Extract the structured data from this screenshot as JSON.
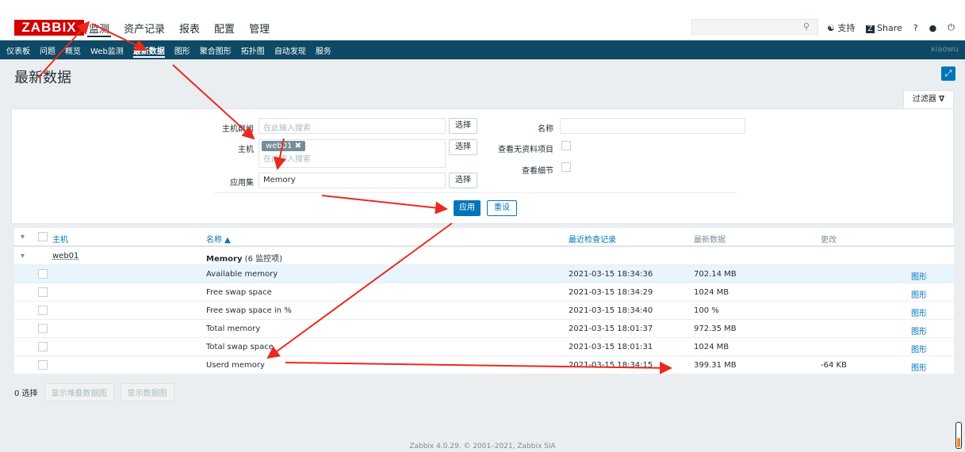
{
  "logo": "ZABBIX",
  "main_menu": [
    "监测",
    "资产记录",
    "报表",
    "配置",
    "管理"
  ],
  "toplinks": {
    "support": "支持",
    "share": "Share",
    "help": "?",
    "user_icon": "user-icon",
    "logout_icon": "power-icon"
  },
  "sub_nav": [
    "仪表板",
    "问题",
    "概览",
    "Web监测",
    "最新数据",
    "图形",
    "聚合图形",
    "拓扑图",
    "自动发现",
    "服务"
  ],
  "sub_nav_user": "xiaowu",
  "page_title": "最新数据",
  "filter": {
    "tab_label": "过滤器",
    "host_group_label": "主机群组",
    "host_group_placeholder": "在此输入搜索",
    "host_label": "主机",
    "host_tag": "web01",
    "host_placeholder": "在此输入搜索",
    "app_label": "应用集",
    "app_value": "Memory",
    "select_label": "选择",
    "name_label": "名称",
    "show_no_data_label": "查看无资料项目",
    "show_details_label": "查看细节",
    "apply": "应用",
    "reset": "重设"
  },
  "table": {
    "headers": {
      "host": "主机",
      "name": "名称 ▲",
      "last_check": "最近检查记录",
      "last_value": "最新数据",
      "change": "更改"
    },
    "group": {
      "host": "web01",
      "name": "Memory",
      "count": "(6 监控项)"
    },
    "rows": [
      {
        "name": "Available memory",
        "last_check": "2021-03-15 18:34:36",
        "last_value": "702.14 MB",
        "change": "",
        "graph": "图形"
      },
      {
        "name": "Free swap space",
        "last_check": "2021-03-15 18:34:29",
        "last_value": "1024 MB",
        "change": "",
        "graph": "图形"
      },
      {
        "name": "Free swap space in %",
        "last_check": "2021-03-15 18:34:40",
        "last_value": "100 %",
        "change": "",
        "graph": "图形"
      },
      {
        "name": "Total memory",
        "last_check": "2021-03-15 18:01:37",
        "last_value": "972.35 MB",
        "change": "",
        "graph": "图形"
      },
      {
        "name": "Total swap space",
        "last_check": "2021-03-15 18:01:31",
        "last_value": "1024 MB",
        "change": "",
        "graph": "图形"
      },
      {
        "name": "Userd memory",
        "last_check": "2021-03-15 18:34:15",
        "last_value": "399.31 MB",
        "change": "-64 KB",
        "graph": "图形"
      }
    ]
  },
  "footer": {
    "selected": "0 选择",
    "stacked_graph": "显示堆叠数据图",
    "graph": "显示数据图"
  },
  "copyright": "Zabbix 4.0.29. © 2001–2021, Zabbix SIA",
  "colors": {
    "brand_red": "#d40000",
    "nav_blue": "#0e4a66",
    "accent": "#0275b8",
    "annotation_arrow": "#ea2a1e"
  }
}
